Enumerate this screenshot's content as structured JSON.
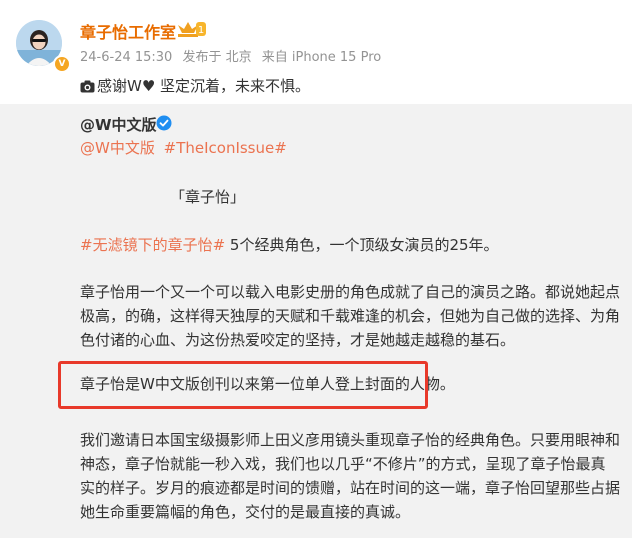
{
  "post": {
    "author": "章子怡工作室",
    "vip_level": "1",
    "timestamp": "24-6-24 15:30",
    "location": "发布于 北京",
    "device": "来自 iPhone 15 Pro",
    "text": "感谢W♥ 坚定沉着，未来不惧。"
  },
  "repost": {
    "author": "@W中文版",
    "tags": [
      "@W中文版",
      "#TheIconIssue#"
    ],
    "quote_title": "「章子怡」",
    "para1_tag": "#无滤镜下的章子怡#",
    "para1_text": " 5个经典角色，一个顶级女演员的25年。",
    "para2": "章子怡用一个又一个可以载入电影史册的角色成就了自己的演员之路。都说她起点极高，的确，这样得天独厚的天赋和千载难逢的机会，但她为自己做的选择、为角色付诸的心血、为这份热爱咬定的坚持，才是她越走越稳的基石。",
    "para3": "章子怡是W中文版创刊以来第一位单人登上封面的人物。",
    "para4": "我们邀请日本国宝级摄影师上田义彦用镜头重现章子怡的经典角色。只要用眼神和神态，章子怡就能一秒入戏，我们也以几乎“不修片”的方式，呈现了章子怡最真实的样子。岁月的痕迹都是时间的馈赠，站在时间的这一端，章子怡回望那些占据她生命重要篇幅的角色，交付的是最直接的真诚。"
  },
  "colors": {
    "author_orange": "#e86c00",
    "link_orange": "#eb7350",
    "highlight_red": "#e8392a",
    "repost_bg": "#f2f2f2",
    "meta_gray": "#939393"
  },
  "icons": [
    "avatar",
    "verified-badge-icon",
    "vip-crown-icon",
    "camera-icon",
    "blue-verified-icon"
  ]
}
